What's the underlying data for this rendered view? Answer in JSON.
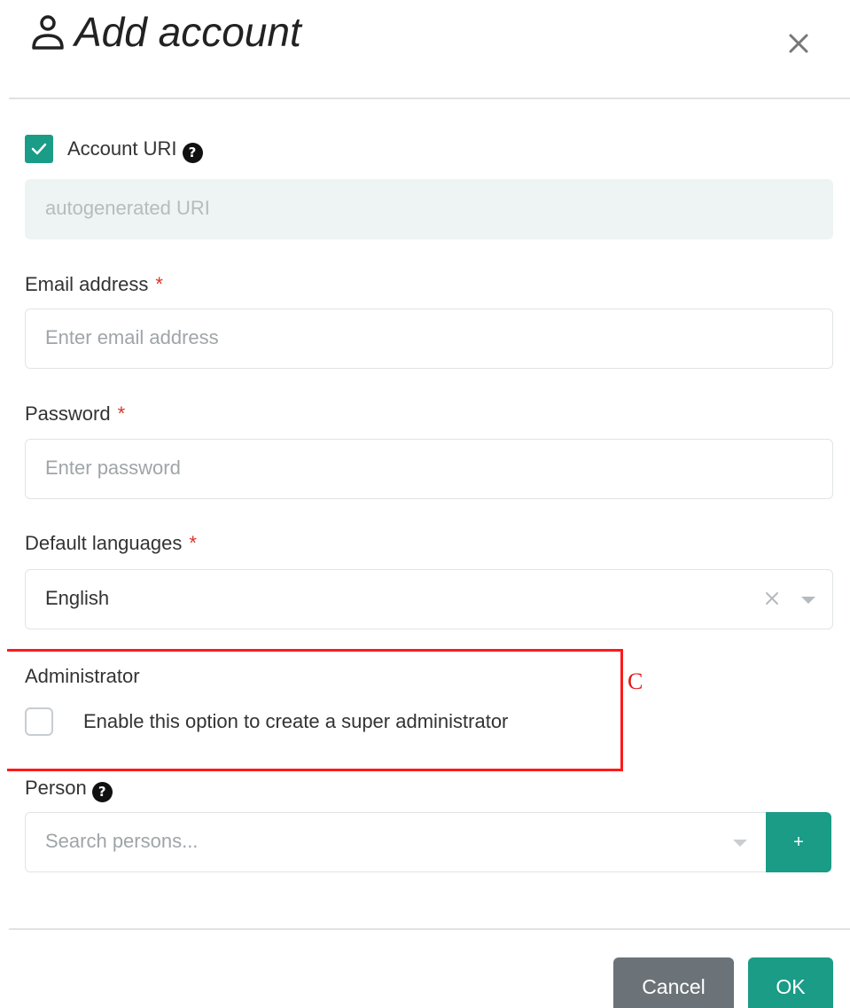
{
  "dialog": {
    "title": "Add account",
    "icon": "user-icon"
  },
  "account_uri": {
    "checked": true,
    "label": "Account URI",
    "value": "autogenerated URI"
  },
  "email": {
    "label": "Email address",
    "required_mark": "*",
    "placeholder": "Enter email address"
  },
  "password": {
    "label": "Password",
    "required_mark": "*",
    "placeholder": "Enter password"
  },
  "default_languages": {
    "label": "Default languages",
    "required_mark": "*",
    "value": "English"
  },
  "administrator": {
    "label": "Administrator",
    "checked": false,
    "option_label": "Enable this option to create a super administrator"
  },
  "annotation": {
    "letter": "C",
    "color": "#e01a1a"
  },
  "person": {
    "label": "Person",
    "placeholder": "Search persons...",
    "add_label": "+"
  },
  "footer": {
    "cancel_label": "Cancel",
    "ok_label": "OK"
  },
  "colors": {
    "accent": "#1a9c87",
    "cancel": "#6b7378",
    "required": "#d9342b"
  }
}
